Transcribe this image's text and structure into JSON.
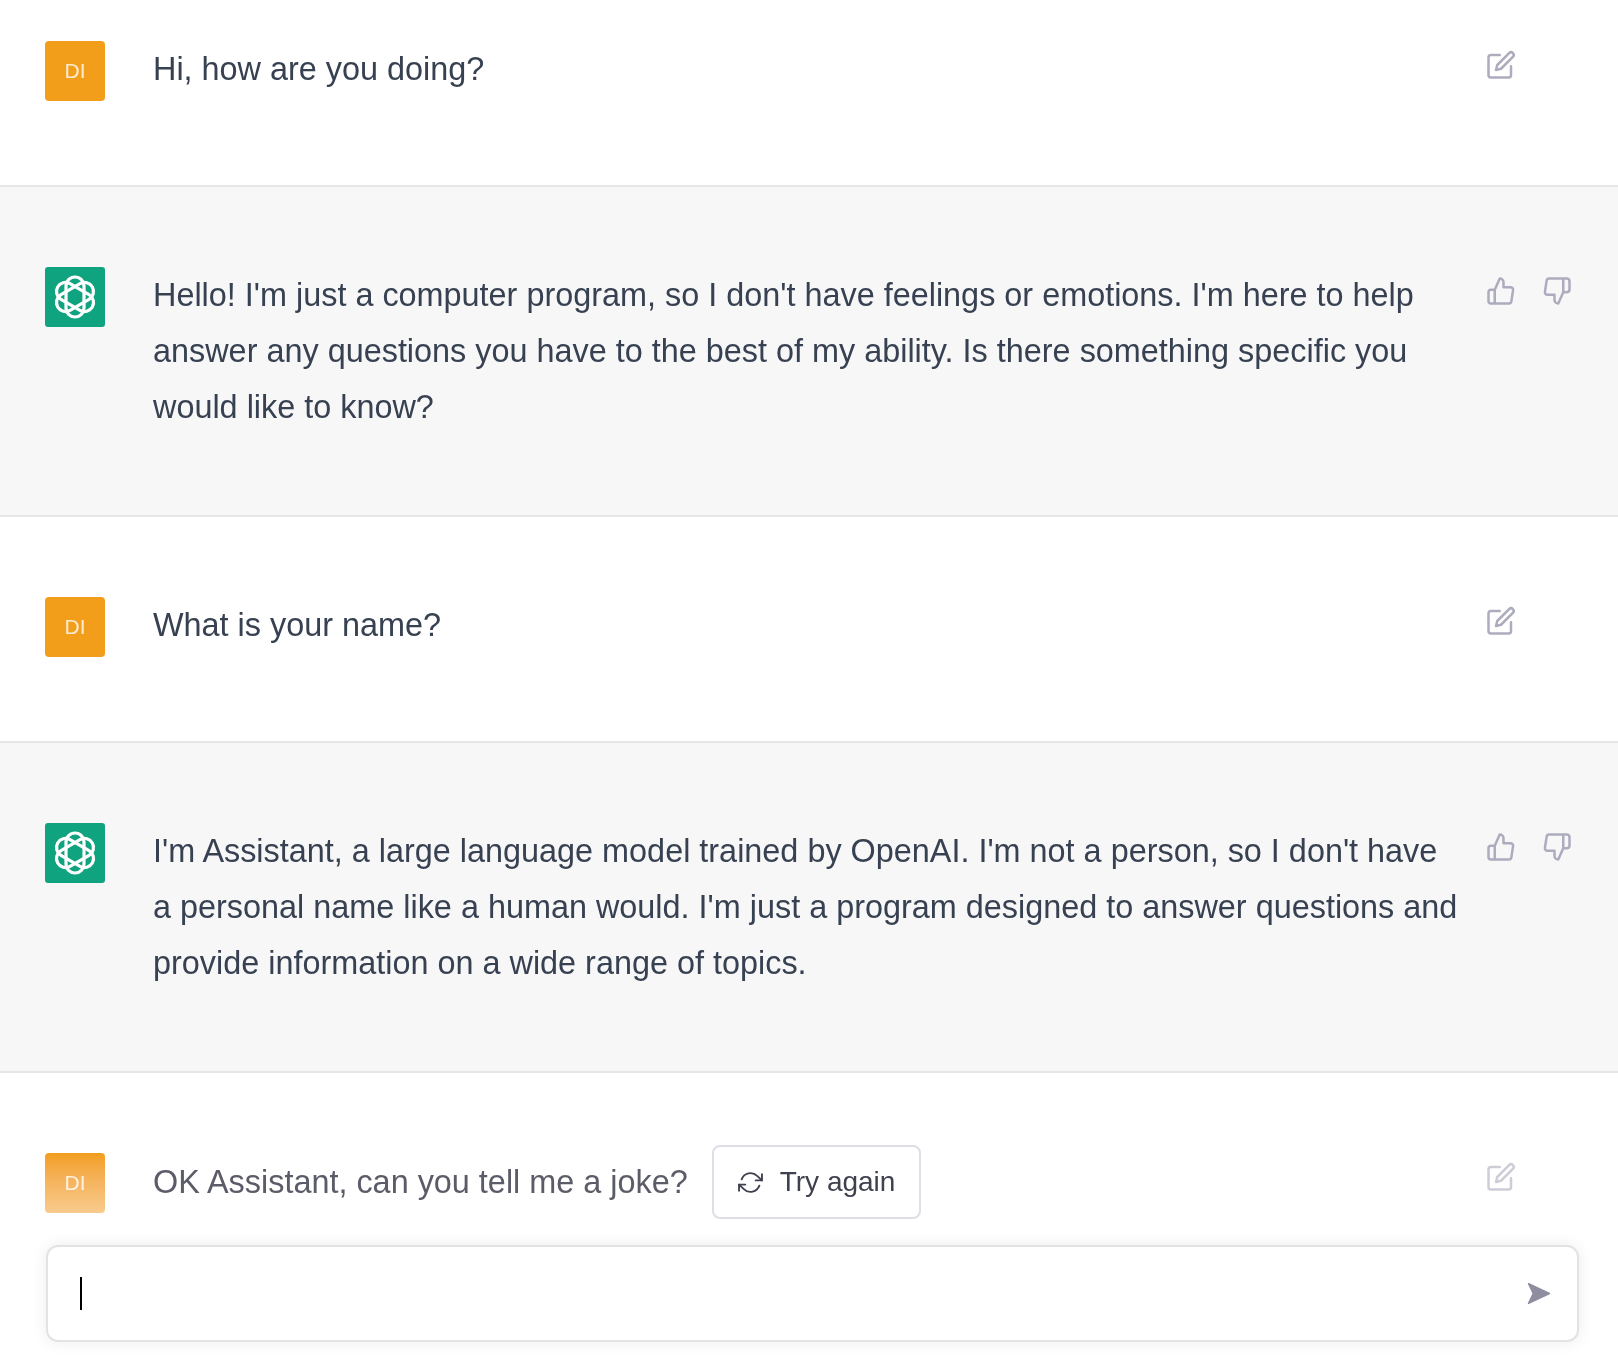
{
  "messages": [
    {
      "kind": "user",
      "avatar": "DI",
      "text": "Hi, how are you doing?"
    },
    {
      "kind": "assistant",
      "text": "Hello! I'm just a computer program, so I don't have feelings or emotions. I'm here to help answer any questions you have to the best of my ability. Is there something specific you would like to know?"
    },
    {
      "kind": "user",
      "avatar": "DI",
      "text": "What is your name?"
    },
    {
      "kind": "assistant",
      "text": "I'm Assistant, a large language model trained by OpenAI. I'm not a person, so I don't have a personal name like a human would. I'm just a program designed to answer questions and provide information on a wide range of topics."
    },
    {
      "kind": "user",
      "avatar": "DI",
      "text": "OK Assistant, can you tell me a joke?"
    }
  ],
  "retry_button": {
    "label": "Try again"
  },
  "composer": {
    "focused": true
  }
}
